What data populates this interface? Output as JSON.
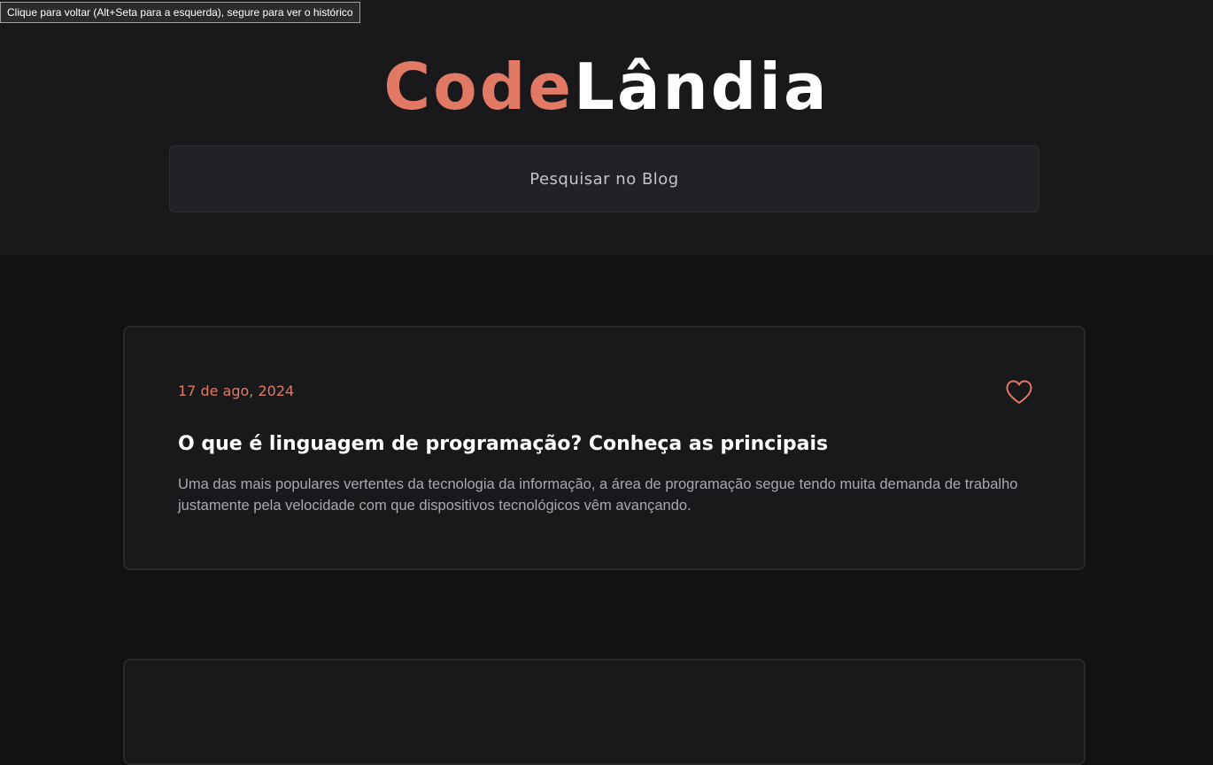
{
  "tooltip": {
    "text": "Clique para voltar (Alt+Seta para a esquerda), segure para ver o histórico"
  },
  "header": {
    "logo_part1": "Code",
    "logo_part2": "Lândia",
    "colors": {
      "accent": "#e27965",
      "logo_secondary": "#ffffff"
    }
  },
  "search": {
    "placeholder": "Pesquisar no Blog"
  },
  "posts": [
    {
      "date": "17 de ago, 2024",
      "title": "O que é linguagem de programação? Conheça as principais",
      "excerpt": "Uma das mais populares vertentes da tecnologia da informação, a área de programação segue tendo muita demanda de trabalho justamente pela velocidade com que dispositivos tecnológicos vêm avançando.",
      "like_icon": "heart-outline-icon"
    }
  ]
}
